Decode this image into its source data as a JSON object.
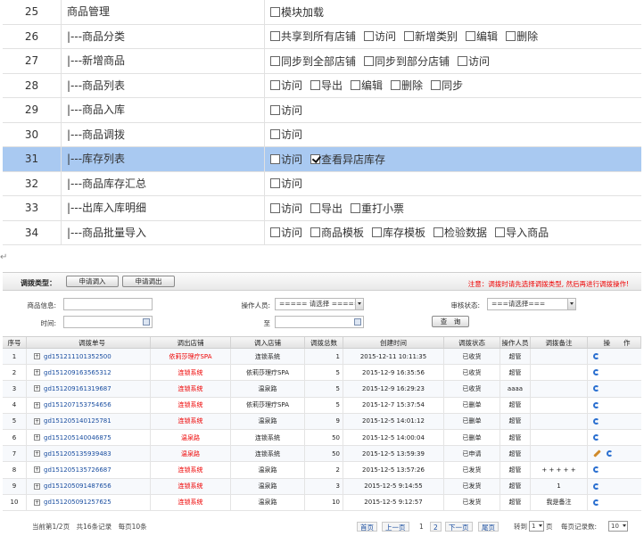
{
  "permissions": [
    {
      "num": "25",
      "name": "商品管理",
      "options": [
        {
          "label": "模块加载",
          "checked": false
        }
      ]
    },
    {
      "num": "26",
      "name": "|---商品分类",
      "options": [
        {
          "label": "共享到所有店铺",
          "checked": false
        },
        {
          "label": "访问",
          "checked": false
        },
        {
          "label": "新增类别",
          "checked": false
        },
        {
          "label": "编辑",
          "checked": false
        },
        {
          "label": "删除",
          "checked": false
        }
      ]
    },
    {
      "num": "27",
      "name": "|---新增商品",
      "options": [
        {
          "label": "同步到全部店铺",
          "checked": false
        },
        {
          "label": "同步到部分店铺",
          "checked": false
        },
        {
          "label": "访问",
          "checked": false
        }
      ]
    },
    {
      "num": "28",
      "name": "|---商品列表",
      "options": [
        {
          "label": "访问",
          "checked": false
        },
        {
          "label": "导出",
          "checked": false
        },
        {
          "label": "编辑",
          "checked": false
        },
        {
          "label": "删除",
          "checked": false
        },
        {
          "label": "同步",
          "checked": false
        }
      ]
    },
    {
      "num": "29",
      "name": "|---商品入库",
      "options": [
        {
          "label": "访问",
          "checked": false
        }
      ]
    },
    {
      "num": "30",
      "name": "|---商品调拨",
      "options": [
        {
          "label": "访问",
          "checked": false
        }
      ]
    },
    {
      "num": "31",
      "name": "|---库存列表",
      "selected": true,
      "options": [
        {
          "label": "访问",
          "checked": false
        },
        {
          "label": "查看异店库存",
          "checked": true
        }
      ]
    },
    {
      "num": "32",
      "name": "|---商品库存汇总",
      "options": [
        {
          "label": "访问",
          "checked": false
        }
      ]
    },
    {
      "num": "33",
      "name": "|---出库入库明细",
      "options": [
        {
          "label": "访问",
          "checked": false
        },
        {
          "label": "导出",
          "checked": false
        },
        {
          "label": "重打小票",
          "checked": false
        }
      ]
    },
    {
      "num": "34",
      "name": "|---商品批量导入",
      "options": [
        {
          "label": "访问",
          "checked": false
        },
        {
          "label": "商品模板",
          "checked": false
        },
        {
          "label": "库存模板",
          "checked": false
        },
        {
          "label": "检验数据",
          "checked": false
        },
        {
          "label": "导入商品",
          "checked": false
        }
      ]
    }
  ],
  "section_mark": "↵",
  "toolbar": {
    "type_label": "调拨类型：",
    "btn_in": "申请调入",
    "btn_out": "申请调出",
    "notice": "注意：调拨时请先选择调拨类型, 然后再进行调拨操作!"
  },
  "filters": {
    "product_label": "商品信息:",
    "operator_label": "操作人员:",
    "operator_value": "===== 请选择 =====",
    "status_label": "审核状态:",
    "status_value": "===请选择===",
    "time_label": "时间:",
    "to_label": "至",
    "query_btn": "查　询"
  },
  "table": {
    "headers": [
      "序号",
      "调拨单号",
      "调出店铺",
      "调入店铺",
      "调拨总数",
      "创建时间",
      "调拨状态",
      "操作人员",
      "调拨备注",
      "操　　作"
    ],
    "rows": [
      {
        "no": "1",
        "order": "gd151211101352500",
        "from": "依莉莎理疗SPA",
        "to": "连锁系统",
        "qty": "1",
        "time": "2015-12-11 10:11:35",
        "status": "已收货",
        "operator": "超管",
        "note": "",
        "edit": false
      },
      {
        "no": "2",
        "order": "gd151209163565312",
        "from": "连锁系统",
        "to": "依莉莎理疗SPA",
        "qty": "5",
        "time": "2015-12-9 16:35:56",
        "status": "已收货",
        "operator": "超管",
        "note": "",
        "edit": false
      },
      {
        "no": "3",
        "order": "gd151209161319687",
        "from": "连锁系统",
        "to": "温泉路",
        "qty": "5",
        "time": "2015-12-9 16:29:23",
        "status": "已收货",
        "operator": "aaaa",
        "note": "",
        "edit": false
      },
      {
        "no": "4",
        "order": "gd151207153754656",
        "from": "连锁系统",
        "to": "依莉莎理疗SPA",
        "qty": "5",
        "time": "2015-12-7 15:37:54",
        "status": "已删单",
        "operator": "超管",
        "note": "",
        "edit": false
      },
      {
        "no": "5",
        "order": "gd151205140125781",
        "from": "连锁系统",
        "to": "温泉路",
        "qty": "9",
        "time": "2015-12-5 14:01:12",
        "status": "已删单",
        "operator": "超管",
        "note": "",
        "edit": false
      },
      {
        "no": "6",
        "order": "gd151205140046875",
        "from": "温泉路",
        "to": "连锁系统",
        "qty": "50",
        "time": "2015-12-5 14:00:04",
        "status": "已删单",
        "operator": "超管",
        "note": "",
        "edit": false
      },
      {
        "no": "7",
        "order": "gd151205135939483",
        "from": "温泉路",
        "to": "连锁系统",
        "qty": "50",
        "time": "2015-12-5 13:59:39",
        "status": "已申请",
        "operator": "超管",
        "note": "",
        "edit": true
      },
      {
        "no": "8",
        "order": "gd151205135726687",
        "from": "连锁系统",
        "to": "温泉路",
        "qty": "2",
        "time": "2015-12-5 13:57:26",
        "status": "已发货",
        "operator": "超管",
        "note": "+ + + + +",
        "edit": false
      },
      {
        "no": "9",
        "order": "gd151205091487656",
        "from": "连锁系统",
        "to": "温泉路",
        "qty": "3",
        "time": "2015-12-5 9:14:55",
        "status": "已发货",
        "operator": "超管",
        "note": "1",
        "edit": false
      },
      {
        "no": "10",
        "order": "gd151205091257625",
        "from": "连锁系统",
        "to": "温泉路",
        "qty": "10",
        "time": "2015-12-5 9:12:57",
        "status": "已发货",
        "operator": "超管",
        "note": "我是备注",
        "edit": false
      }
    ]
  },
  "pager": {
    "summary": "当前第1/2页　共16条记录　每页10条",
    "first": "首页",
    "prev": "上一页",
    "page1": "1",
    "page2": "2",
    "next": "下一页",
    "last": "尾页",
    "goto_label": "转到",
    "goto_value": "1",
    "goto_unit": "页",
    "per_page_label": "每页记录数:",
    "per_page_value": "10"
  },
  "colors": {
    "selected_row": "#a9c9f1",
    "notice": "#ee0000",
    "link": "#1a4ea0"
  }
}
